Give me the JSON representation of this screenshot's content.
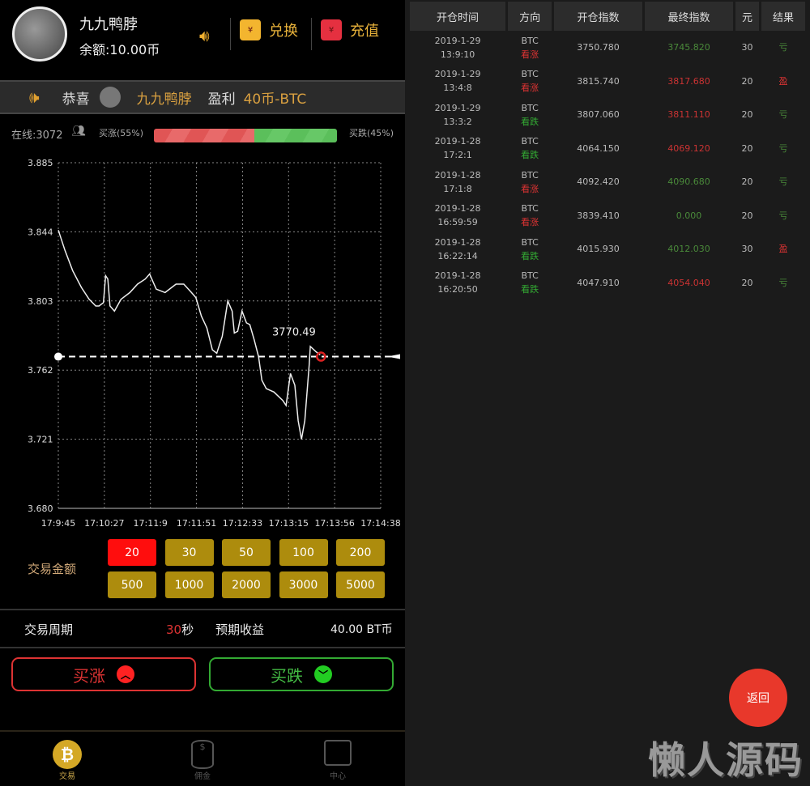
{
  "header": {
    "username": "九九鸭脖",
    "balance": "余额:10.00币",
    "exchange_label": "兑换",
    "recharge_label": "充值"
  },
  "notice": {
    "prefix": "恭喜",
    "name": "九九鸭脖",
    "action": "盈利",
    "amount": "40币-BTC"
  },
  "stats": {
    "online": "在线:3072",
    "buy_up": "买涨(55%)",
    "buy_down": "买跌(45%)",
    "up_percent": 55,
    "down_percent": 45
  },
  "colors": {
    "up": "#e05555",
    "down": "#5bbf5b",
    "gold": "#ad8c0d",
    "accent": "#e8382b"
  },
  "chart_data": {
    "type": "line",
    "title": "",
    "xlabel": "",
    "ylabel": "",
    "yticks": [
      "3.885",
      "3.844",
      "3.803",
      "3.762",
      "3.721",
      "3.680"
    ],
    "ylim": [
      3.68,
      3.885
    ],
    "xticks": [
      "17:9:45",
      "17:10:27",
      "17:11:9",
      "17:11:51",
      "17:12:33",
      "17:13:15",
      "17:13:56",
      "17:14:38"
    ],
    "xlim_seconds": [
      0,
      293
    ],
    "current_value_label": "3770.49",
    "current_value": 3.77,
    "series": [
      {
        "name": "BTC",
        "points": [
          [
            0,
            3.845
          ],
          [
            6,
            3.833
          ],
          [
            13,
            3.821
          ],
          [
            21,
            3.811
          ],
          [
            28,
            3.804
          ],
          [
            34,
            3.8
          ],
          [
            37,
            3.8
          ],
          [
            41,
            3.802
          ],
          [
            43,
            3.818
          ],
          [
            45,
            3.816
          ],
          [
            47,
            3.8
          ],
          [
            51,
            3.797
          ],
          [
            57,
            3.804
          ],
          [
            65,
            3.808
          ],
          [
            72,
            3.813
          ],
          [
            79,
            3.816
          ],
          [
            83,
            3.819
          ],
          [
            89,
            3.81
          ],
          [
            97,
            3.808
          ],
          [
            107,
            3.813
          ],
          [
            114,
            3.813
          ],
          [
            121,
            3.808
          ],
          [
            125,
            3.805
          ],
          [
            130,
            3.794
          ],
          [
            135,
            3.787
          ],
          [
            140,
            3.774
          ],
          [
            144,
            3.772
          ],
          [
            149,
            3.782
          ],
          [
            154,
            3.803
          ],
          [
            158,
            3.797
          ],
          [
            160,
            3.784
          ],
          [
            163,
            3.785
          ],
          [
            167,
            3.797
          ],
          [
            171,
            3.79
          ],
          [
            174,
            3.789
          ],
          [
            178,
            3.78
          ],
          [
            182,
            3.77
          ],
          [
            185,
            3.756
          ],
          [
            189,
            3.751
          ],
          [
            196,
            3.749
          ],
          [
            204,
            3.744
          ],
          [
            207,
            3.741
          ],
          [
            211,
            3.76
          ],
          [
            215,
            3.753
          ],
          [
            218,
            3.732
          ],
          [
            221,
            3.721
          ],
          [
            224,
            3.732
          ],
          [
            228,
            3.765
          ],
          [
            229,
            3.776
          ],
          [
            234,
            3.773
          ],
          [
            238,
            3.771
          ]
        ]
      }
    ]
  },
  "amount": {
    "label": "交易金额",
    "options": [
      "20",
      "30",
      "50",
      "100",
      "200",
      "500",
      "1000",
      "2000",
      "3000",
      "5000"
    ],
    "selected": "20"
  },
  "period": {
    "label": "交易周期",
    "value": "30",
    "unit": "秒",
    "expected_label": "预期收益",
    "expected_value": "40.00 BT币"
  },
  "actions": {
    "buy_up": "买涨",
    "buy_down": "买跌"
  },
  "nav": [
    {
      "label": "交易"
    },
    {
      "label": "佣金"
    },
    {
      "label": "中心"
    }
  ],
  "table": {
    "headers": [
      "开仓时间",
      "方向",
      "开仓指数",
      "最终指数",
      "元",
      "结果"
    ],
    "rows": [
      {
        "date": "2019-1-29",
        "time": "13:9:10",
        "asset": "BTC",
        "dir": "看涨",
        "dir_up": true,
        "open": "3750.780",
        "final": "3745.820",
        "final_up": false,
        "amount": "30",
        "result": "亏",
        "win": false
      },
      {
        "date": "2019-1-29",
        "time": "13:4:8",
        "asset": "BTC",
        "dir": "看涨",
        "dir_up": true,
        "open": "3815.740",
        "final": "3817.680",
        "final_up": true,
        "amount": "20",
        "result": "盈",
        "win": true
      },
      {
        "date": "2019-1-29",
        "time": "13:3:2",
        "asset": "BTC",
        "dir": "看跌",
        "dir_up": false,
        "open": "3807.060",
        "final": "3811.110",
        "final_up": true,
        "amount": "20",
        "result": "亏",
        "win": false
      },
      {
        "date": "2019-1-28",
        "time": "17:2:1",
        "asset": "BTC",
        "dir": "看跌",
        "dir_up": false,
        "open": "4064.150",
        "final": "4069.120",
        "final_up": true,
        "amount": "20",
        "result": "亏",
        "win": false
      },
      {
        "date": "2019-1-28",
        "time": "17:1:8",
        "asset": "BTC",
        "dir": "看涨",
        "dir_up": true,
        "open": "4092.420",
        "final": "4090.680",
        "final_up": false,
        "amount": "20",
        "result": "亏",
        "win": false
      },
      {
        "date": "2019-1-28",
        "time": "16:59:59",
        "asset": "BTC",
        "dir": "看涨",
        "dir_up": true,
        "open": "3839.410",
        "final": "0.000",
        "final_up": false,
        "amount": "20",
        "result": "亏",
        "win": false
      },
      {
        "date": "2019-1-28",
        "time": "16:22:14",
        "asset": "BTC",
        "dir": "看跌",
        "dir_up": false,
        "open": "4015.930",
        "final": "4012.030",
        "final_up": false,
        "amount": "30",
        "result": "盈",
        "win": true
      },
      {
        "date": "2019-1-28",
        "time": "16:20:50",
        "asset": "BTC",
        "dir": "看跌",
        "dir_up": false,
        "open": "4047.910",
        "final": "4054.040",
        "final_up": true,
        "amount": "20",
        "result": "亏",
        "win": false
      }
    ]
  },
  "back_label": "返回",
  "watermark": "懒人源码"
}
